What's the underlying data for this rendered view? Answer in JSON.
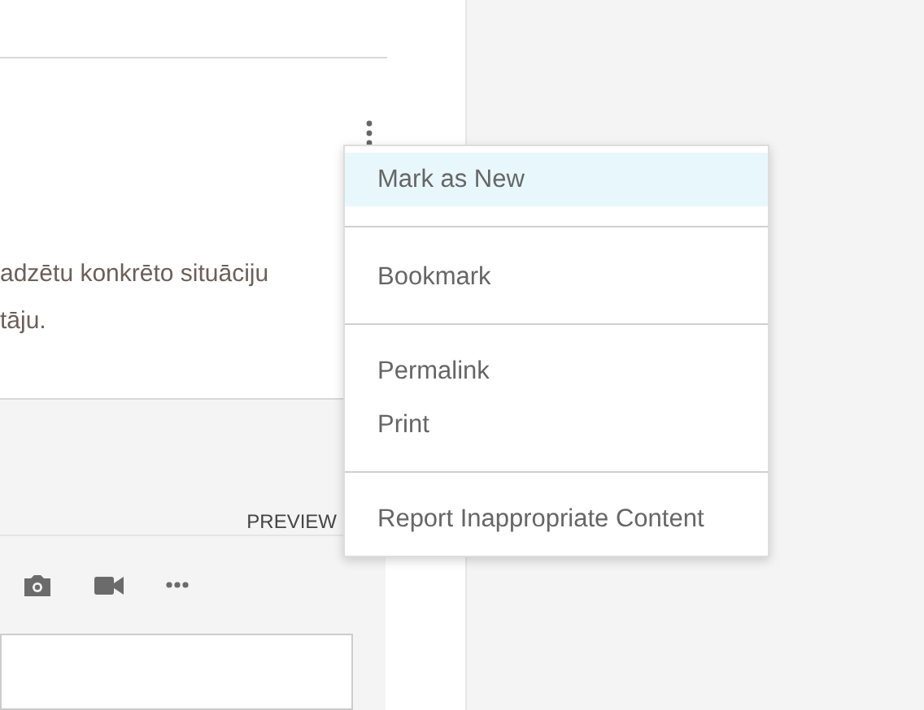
{
  "post": {
    "text_lines": [
      "adzētu konkrēto situāciju",
      "tāju."
    ]
  },
  "reply_editor": {
    "preview_label": "PREVIEW"
  },
  "options_menu": {
    "sections": [
      [
        {
          "label": "Mark as New",
          "selected": true
        }
      ],
      [
        {
          "label": "Bookmark",
          "selected": false
        }
      ],
      [
        {
          "label": "Permalink",
          "selected": false
        },
        {
          "label": "Print",
          "selected": false
        }
      ],
      [
        {
          "label": "Report Inappropriate Content",
          "selected": false
        }
      ]
    ]
  }
}
